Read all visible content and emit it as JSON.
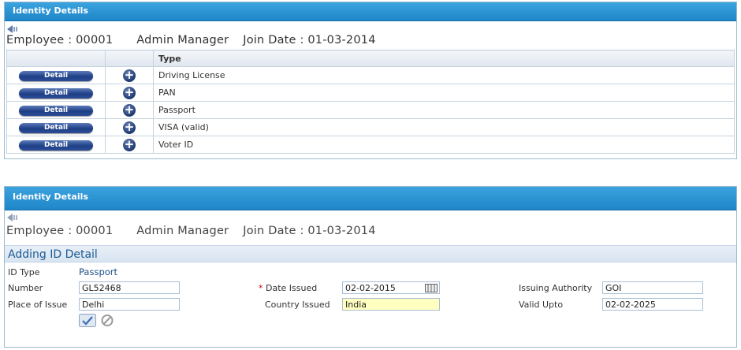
{
  "panel1": {
    "title": "Identity Details",
    "employee_label": "Employee : 00001",
    "role": "Admin Manager",
    "join_date": "Join Date : 01-03-2014",
    "table": {
      "headers": [
        "",
        "",
        "Type"
      ],
      "rows": [
        {
          "detail": "Detail",
          "type": "Driving License"
        },
        {
          "detail": "Detail",
          "type": "PAN"
        },
        {
          "detail": "Detail",
          "type": "Passport"
        },
        {
          "detail": "Detail",
          "type": "VISA (valid)"
        },
        {
          "detail": "Detail",
          "type": "Voter ID"
        }
      ]
    }
  },
  "panel2": {
    "title": "Identity Details",
    "employee_label": "Employee : 00001",
    "role": "Admin Manager",
    "join_date": "Join Date : 01-03-2014",
    "section_title": "Adding ID Detail",
    "id_type_label": "ID Type",
    "id_type_value": "Passport",
    "number_label": "Number",
    "number_value": "GL52468",
    "date_issued_label": "Date Issued",
    "date_issued_value": "02-02-2015",
    "issuing_authority_label": "Issuing Authority",
    "issuing_authority_value": "GOI",
    "place_label": "Place of Issue",
    "place_value": "Delhi",
    "country_label": "Country Issued",
    "country_value": "India",
    "valid_label": "Valid Upto",
    "valid_value": "02-02-2025"
  },
  "colors": {
    "titlebar": "#1f86c8",
    "detail_button": "#1e3f86",
    "section_text": "#1d5a93",
    "highlight_field": "#ffffc0"
  }
}
